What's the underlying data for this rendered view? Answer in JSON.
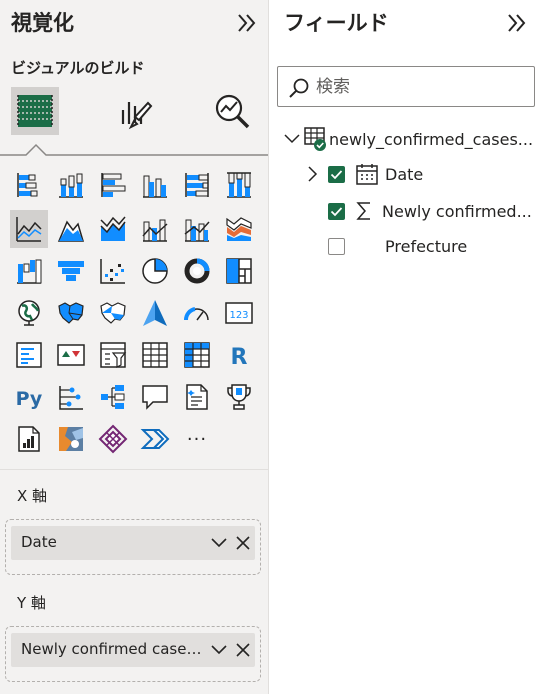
{
  "visualizations": {
    "title": "視覚化",
    "build_label": "ビジュアルのビルド",
    "more_label": "···",
    "x_axis": {
      "label": "X 軸",
      "field": "Date"
    },
    "y_axis": {
      "label": "Y 軸",
      "field": "Newly confirmed cases..."
    },
    "colors": {
      "accent": "#118dff",
      "light_accent": "#a8c9f0",
      "selected_bg": "#d2d0ce"
    }
  },
  "fields": {
    "title": "フィールド",
    "search_placeholder": "検索",
    "table_name": "newly_confirmed_cases...",
    "items": [
      {
        "label": "Date",
        "checked": true,
        "icon": "calendar-icon"
      },
      {
        "label": "Newly confirmed...",
        "checked": true,
        "icon": "sigma-icon"
      },
      {
        "label": "Prefecture",
        "checked": false,
        "icon": "none"
      }
    ],
    "colors": {
      "check_green": "#1b6d47"
    }
  }
}
